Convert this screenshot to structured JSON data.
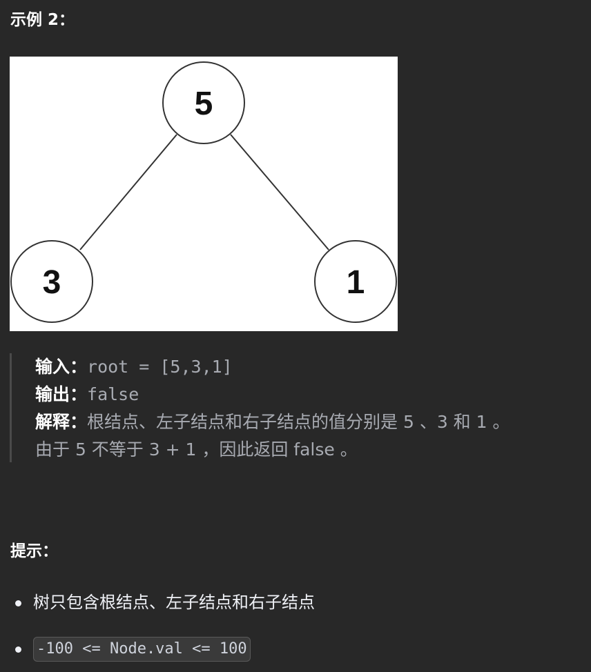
{
  "example": {
    "heading": "示例 2：",
    "tree": {
      "nodes": {
        "root": "5",
        "left": "3",
        "right": "1"
      }
    },
    "input_label": "输入：",
    "input_value": "root = [5,3,1]",
    "output_label": "输出：",
    "output_value": "false",
    "explain_label": "解释：",
    "explain_text": "根结点、左子结点和右子结点的值分别是 5 、3 和 1 。",
    "explain_text_2": "由于 5 不等于 3 + 1 ，因此返回 false 。"
  },
  "hints": {
    "heading": "提示：",
    "items": [
      "树只包含根结点、左子结点和右子结点",
      "-100 <= Node.val <= 100"
    ]
  }
}
